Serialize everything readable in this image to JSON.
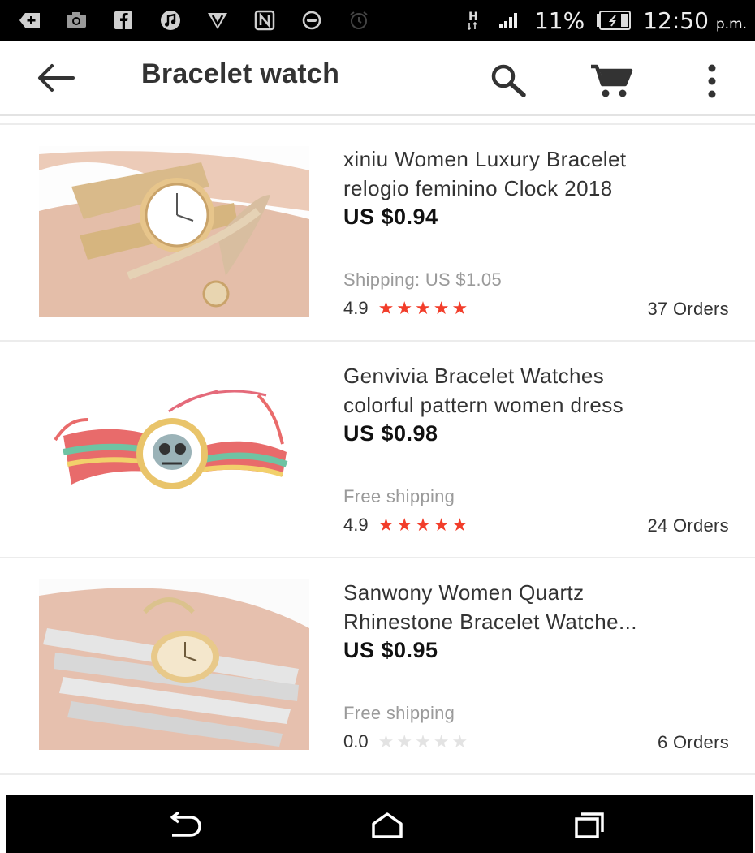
{
  "status_bar": {
    "battery": "11%",
    "time": "12:50",
    "time_suffix": "p.m.",
    "network": "H",
    "icons": [
      "plus-icon",
      "camera-icon",
      "facebook-icon",
      "music-icon",
      "vpn-shield-icon",
      "nfc-icon",
      "sync-icon",
      "alarm-icon",
      "signal-icon",
      "battery-icon"
    ]
  },
  "app_bar": {
    "title": "Bracelet watch",
    "icons": [
      "back-arrow-icon",
      "search-icon",
      "cart-icon",
      "more-vert-icon"
    ]
  },
  "products": [
    {
      "title_line1": "xiniu Women Luxury Bracelet",
      "title_line2": "relogio feminino Clock 2018",
      "price": "US $0.94",
      "shipping": "Shipping: US $1.05",
      "rating": "4.9",
      "stars": 5,
      "orders": "37 Orders"
    },
    {
      "title_line1": "Genvivia Bracelet Watches",
      "title_line2": "colorful pattern women dress",
      "price": "US $0.98",
      "shipping": "Free shipping",
      "rating": "4.9",
      "stars": 5,
      "orders": "24 Orders"
    },
    {
      "title_line1": "Sanwony Women Quartz",
      "title_line2": "Rhinestone Bracelet Watche...",
      "price": "US $0.95",
      "shipping": "Free shipping",
      "rating": "0.0",
      "stars": 0,
      "orders": "6 Orders"
    }
  ],
  "nav_bar": {
    "icons": [
      "nav-back-icon",
      "nav-home-icon",
      "nav-recents-icon"
    ]
  },
  "colors": {
    "star_active": "#f23d2a",
    "star_inactive": "#e3e3e3",
    "shipping_text": "#9a9a9a"
  }
}
